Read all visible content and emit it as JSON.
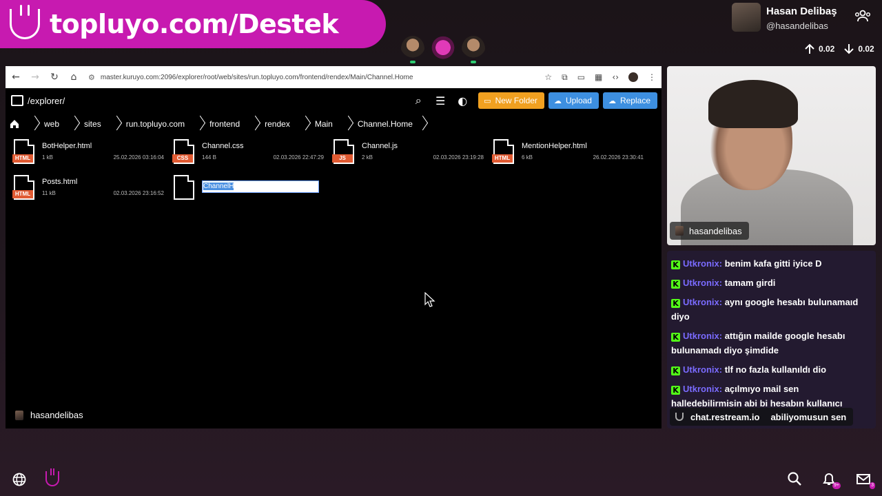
{
  "banner": {
    "title": "topluyo.com/Destek",
    "logo_icon": "smile-logo-icon",
    "color": "#c71ab0"
  },
  "streamer": {
    "name": "Hasan Delibaş",
    "handle": "@hasandelibas"
  },
  "stats": {
    "upload": "0.02",
    "download": "0.02"
  },
  "browser": {
    "url": "master.kuruyo.com:2096/explorer/root/web/sites/run.topluyo.com/frontend/rendex/Main/Channel.Home"
  },
  "explorer": {
    "path": "/explorer/",
    "buttons": {
      "new_folder": "New Folder",
      "upload": "Upload",
      "replace": "Replace"
    },
    "breadcrumb": [
      "web",
      "sites",
      "run.topluyo.com",
      "frontend",
      "rendex",
      "Main",
      "Channel.Home"
    ],
    "files": [
      {
        "name": "BotHelper.html",
        "size": "1 kB",
        "date": "25.02.2026 03:16:04",
        "type": "HTML",
        "color": "#e05a32"
      },
      {
        "name": "Channel.css",
        "size": "144 B",
        "date": "02.03.2026 22:47:29",
        "type": "CSS",
        "color": "#e05a32"
      },
      {
        "name": "Channel.js",
        "size": "2 kB",
        "date": "02.03.2026 23:19:28",
        "type": "JS",
        "color": "#e05a32"
      },
      {
        "name": "MentionHelper.html",
        "size": "6 kB",
        "date": "26.02.2026 23:30:41",
        "type": "HTML",
        "color": "#e05a32"
      },
      {
        "name": "Posts.html",
        "size": "11 kB",
        "date": "02.03.2026 23:16:52",
        "type": "HTML",
        "color": "#e05a32"
      }
    ],
    "rename_value": "ChannelH",
    "footer_user": "hasandelibas"
  },
  "webcam": {
    "label": "hasandelibas"
  },
  "chat": {
    "messages": [
      {
        "user": "Utkronix",
        "text": "benim kafa gitti iyice D"
      },
      {
        "user": "Utkronix",
        "text": "tamam girdi"
      },
      {
        "user": "Utkronix",
        "text": "aynı google hesabı bulunamaıd diyo"
      },
      {
        "user": "Utkronix",
        "text": "attığın mailde google hesabı bulunamadı diyo şimdide"
      },
      {
        "user": "Utkronix",
        "text": "tlf no fazla kullanıldı dio"
      },
      {
        "user": "Utkronix",
        "text": "açılmıyo mail sen halledebilirmisin abi bi hesabın kullanıcı"
      },
      {
        "user": "",
        "text": "abiliyomusun sen"
      }
    ],
    "footer": "chat.restream.io"
  },
  "bottom": {
    "notif_badge": "9+",
    "mail_badge": "3"
  }
}
